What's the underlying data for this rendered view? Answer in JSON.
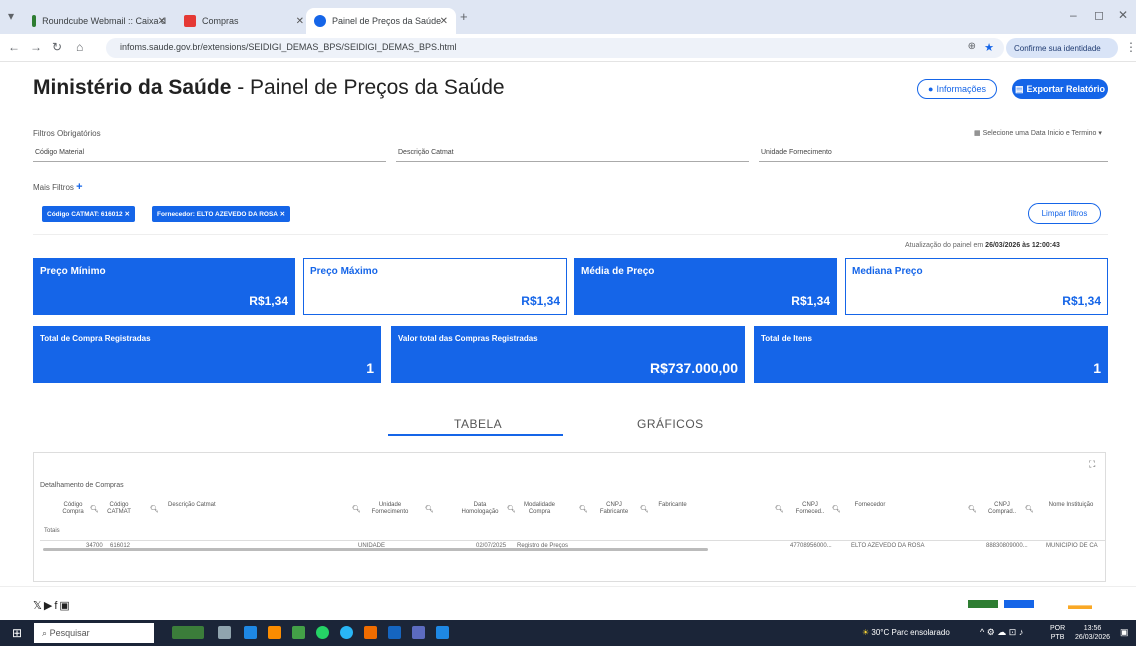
{
  "browser": {
    "tabs": [
      {
        "label": "Roundcube Webmail :: Caixa d",
        "color": "#2e7d32"
      },
      {
        "label": "Compras",
        "color": "#e53935"
      },
      {
        "label": "Painel de Preços da Saúde",
        "color": "#1565e8"
      }
    ],
    "url": "infoms.saude.gov.br/extensions/SEIDIGI_DEMAS_BPS/SEIDIGI_DEMAS_BPS.html",
    "identity_label": "Confirme sua identidade"
  },
  "header": {
    "title_bold": "Ministério da Saúde",
    "title_rest": " - Painel de Preços da Saúde",
    "info_button": "Informações",
    "export_button": "Exportar Relatório"
  },
  "filters": {
    "section_label": "Filtros Obrigatórios",
    "date_selector": "Selecione uma Data Inicio e Termino",
    "fields": [
      "Código Material",
      "Descrição Catmat",
      "Unidade Fornecimento"
    ],
    "more_filters": "Mais Filtros",
    "chips": [
      {
        "key": "Código CATMAT:",
        "value": "616012"
      },
      {
        "key": "Fornecedor:",
        "value": "ELTO AZEVEDO DA ROSA"
      }
    ],
    "clear_button": "Limpar filtros"
  },
  "update": {
    "label": "Atualização do painel em",
    "datetime": "26/03/2026 às 12:00:43"
  },
  "kpis": [
    {
      "title": "Preço Mínimo",
      "value": "R$1,34"
    },
    {
      "title": "Preço Máximo",
      "value": "R$1,34"
    },
    {
      "title": "Média de Preço",
      "value": "R$1,34"
    },
    {
      "title": "Mediana Preço",
      "value": "R$1,34"
    }
  ],
  "totals": [
    {
      "title": "Total de Compra Registradas",
      "value": "1"
    },
    {
      "title": "Valor total das Compras Registradas",
      "value": "R$737.000,00"
    },
    {
      "title": "Total de Itens",
      "value": "1"
    }
  ],
  "view_tabs": [
    "TABELA",
    "GRÁFICOS"
  ],
  "table": {
    "title": "Detalhamento de Compras",
    "columns": [
      "Código Compra",
      "Código CATMAT",
      "Descrição Catmat",
      "Unidade Fornecimento",
      "Data Homologação",
      "Modalidade Compra",
      "CNPJ Fabricante",
      "Fabricante",
      "CNPJ Forneced..",
      "Fornecedor",
      "CNPJ Comprad..",
      "Nome Instituição"
    ],
    "totals_label": "Totais",
    "row": [
      "34700",
      "616012",
      "UNIDADE",
      "02/07/2025",
      "Registro de Preços",
      "47708956000...",
      "ELTO AZEVEDO DA ROSA",
      "88830809000...",
      "MUNICIPIO DE CA"
    ]
  },
  "taskbar": {
    "search_placeholder": "Pesquisar",
    "weather": "30°C Parc ensolarado",
    "lang": "POR",
    "layout": "PTB",
    "time": "13:56",
    "date": "26/03/2026"
  },
  "accent": "#1565e8"
}
